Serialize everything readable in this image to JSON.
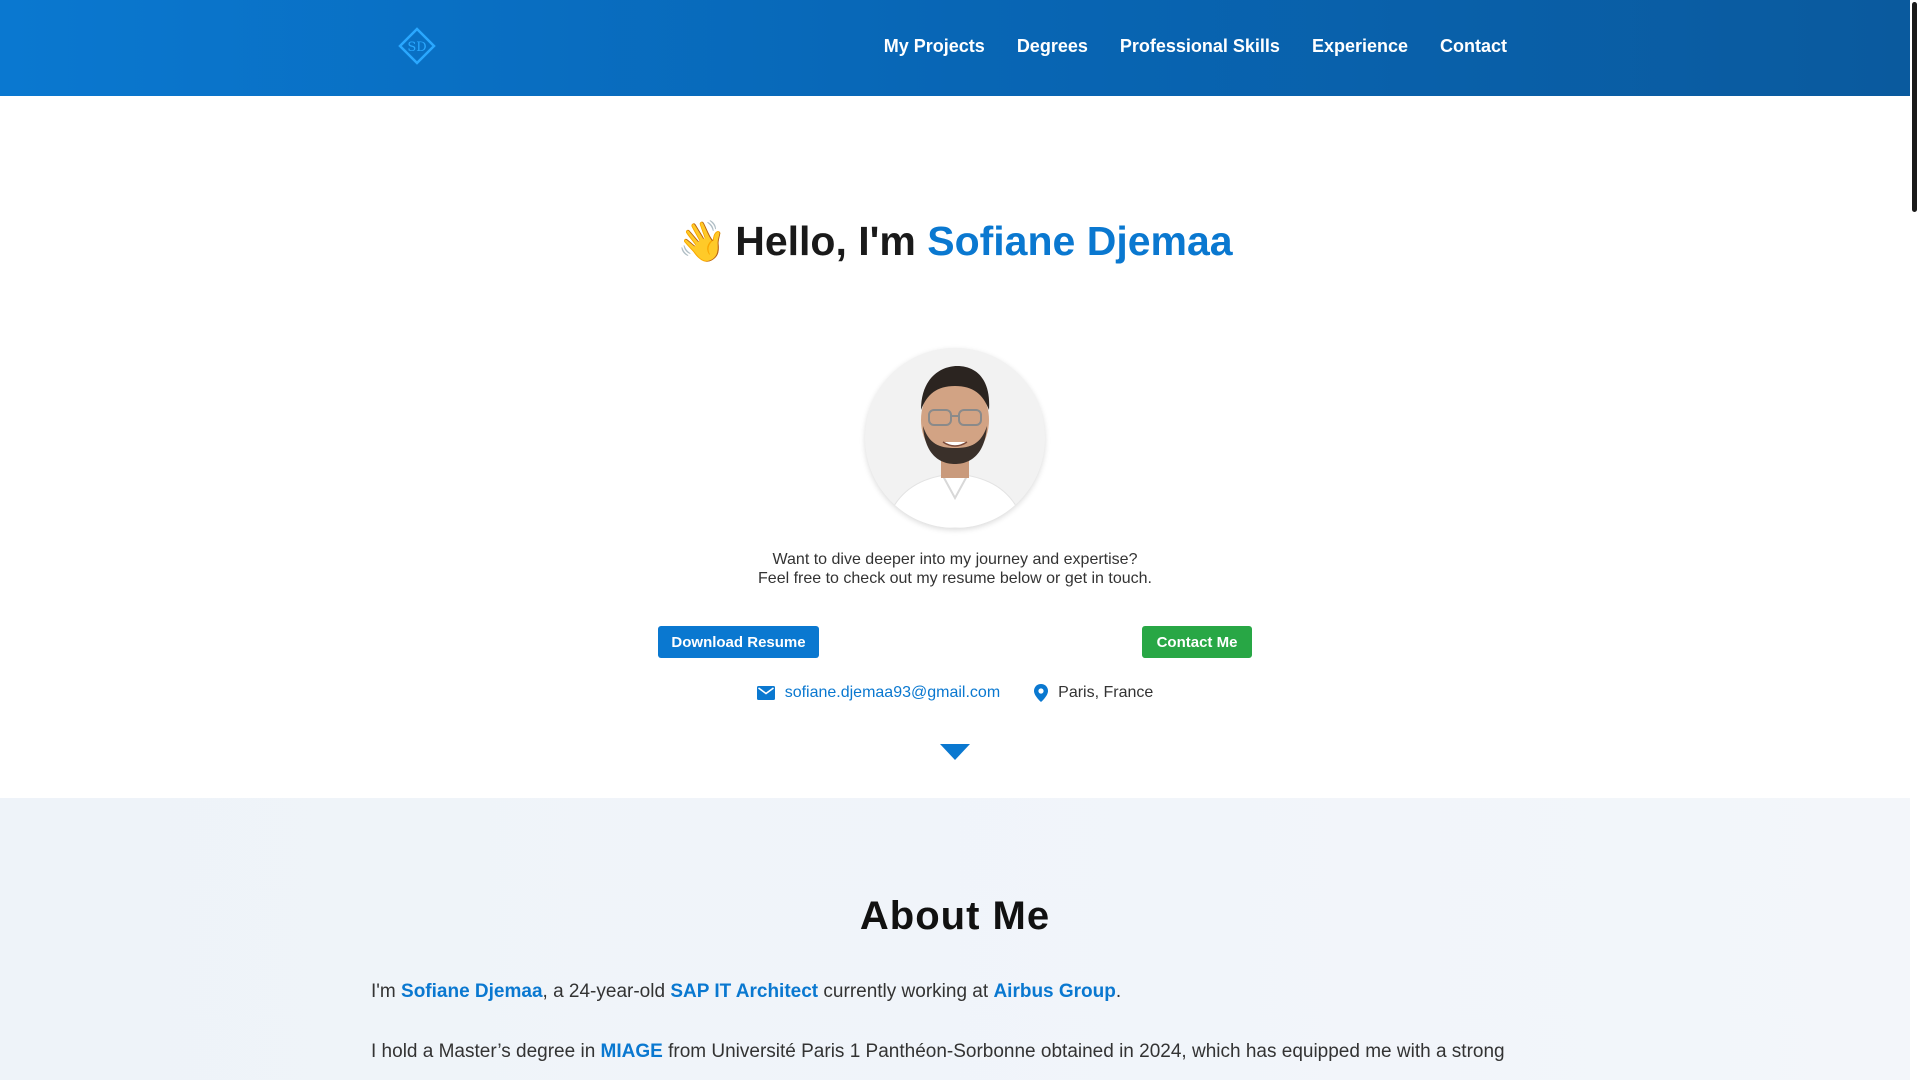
{
  "header": {
    "logo_icon": "sd-diamond-logo-icon",
    "nav": [
      "My Projects",
      "Degrees",
      "Professional Skills",
      "Experience",
      "Contact"
    ]
  },
  "hero": {
    "wave_emoji": "👋",
    "greeting": "Hello, I'm",
    "name": "Sofiane Djemaa",
    "intro_line1": "Want to dive deeper into my journey and expertise?",
    "intro_line2": "Feel free to check out my resume below or get in touch.",
    "download_resume_label": "Download Resume",
    "contact_me_label": "Contact Me",
    "email": "sofiane.djemaa93@gmail.com",
    "location": "Paris, France"
  },
  "about": {
    "title": "About Me",
    "p1_a": "I'm ",
    "p1_name": "Sofiane Djemaa",
    "p1_b": ", a 24-year-old ",
    "p1_role": "SAP IT Architect",
    "p1_c": " currently working at ",
    "p1_company": "Airbus Group",
    "p1_d": ".",
    "p2_a": "I hold a Master’s degree in ",
    "p2_degree": "MIAGE",
    "p2_b": " from Université Paris 1 Panthéon-Sorbonne obtained in 2024, which has equipped me with a strong"
  },
  "colors": {
    "accent": "#0a78d0",
    "contact_button": "#28a745"
  }
}
